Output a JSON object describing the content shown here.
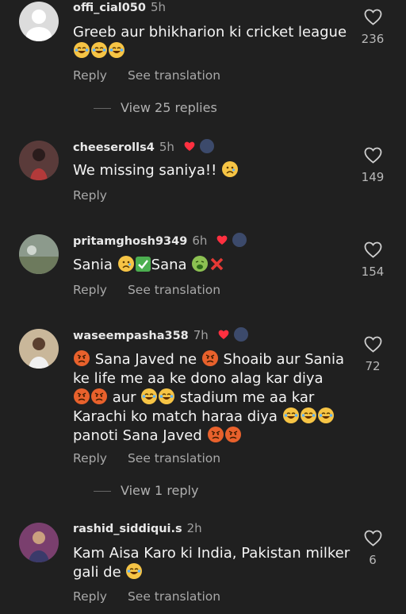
{
  "comments": [
    {
      "username": "offi_cial050",
      "time": "5h",
      "text": "Greeb aur bhikharion ki cricket league",
      "emojis": [
        "laugh",
        "laugh",
        "laugh"
      ],
      "likes": "236",
      "reply_label": "Reply",
      "translate_label": "See translation",
      "view_replies": "View 25 replies"
    },
    {
      "username": "cheeserolls4",
      "time": "5h",
      "text": "We missing saniya!!",
      "likes": "149",
      "reply_label": "Reply"
    },
    {
      "username": "pritamghosh9349",
      "time": "6h",
      "text1": "Sania",
      "text2": "Sana",
      "likes": "154",
      "reply_label": "Reply",
      "translate_label": "See translation"
    },
    {
      "username": "waseempasha358",
      "time": "7h",
      "seg1": "Sana Javed ne",
      "seg2": "Shoaib  aur Sania",
      "line2": "ke life me aa ke dono alag kar diya",
      "seg3": "aur",
      "seg4": "stadium me aa kar",
      "line4": "Karachi ko match haraa diya",
      "line5": "panoti Sana Javed",
      "likes": "72",
      "reply_label": "Reply",
      "translate_label": "See translation",
      "view_replies": "View 1 reply"
    },
    {
      "username": "rashid_siddiqui.s",
      "time": "2h",
      "line1": "Kam Aisa Karo ki India, Pakistan milker",
      "line2": "gali de",
      "likes": "6",
      "reply_label": "Reply",
      "translate_label": "See translation"
    }
  ],
  "colors": {
    "background": "#202020",
    "heart_red": "#ff3040",
    "secondary_text": "#a8a8a8"
  }
}
